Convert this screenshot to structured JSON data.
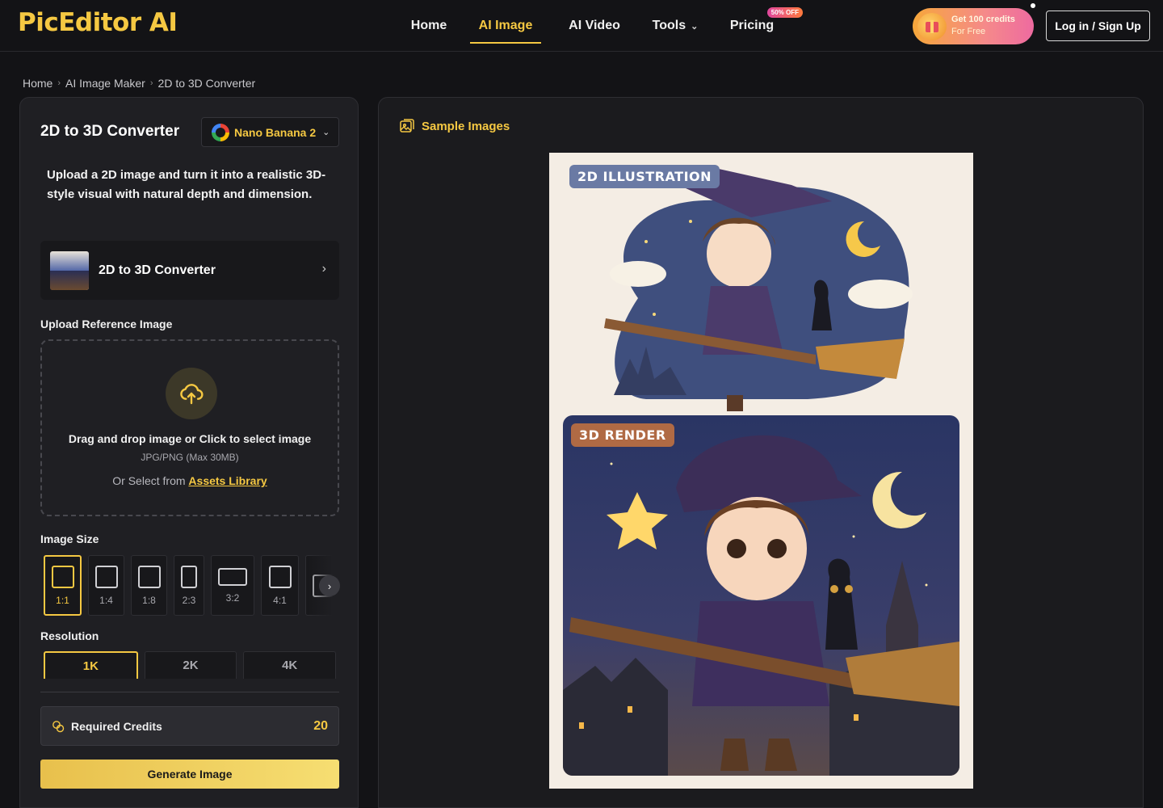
{
  "header": {
    "logo": "PicEditor AI",
    "nav": [
      {
        "label": "Home"
      },
      {
        "label": "AI Image"
      },
      {
        "label": "AI Video"
      },
      {
        "label": "Tools"
      },
      {
        "label": "Pricing"
      }
    ],
    "pricing_badge": "50% OFF",
    "promo_line1": "Get 100 credits",
    "promo_line2": "For Free",
    "login_label": "Log in / Sign Up"
  },
  "breadcrumb": [
    "Home",
    "AI Image Maker",
    "2D to 3D Converter"
  ],
  "tool": {
    "title": "2D to 3D Converter",
    "model": "Nano Banana 2",
    "description": "Upload a 2D image and turn it into a realistic 3D-style visual with natural depth and dimension.",
    "template_label": "2D to 3D Converter",
    "upload_section_label": "Upload Reference Image",
    "upload_main_text": "Drag and drop image or Click to select image",
    "upload_format_text": "JPG/PNG (Max 30MB)",
    "upload_assets_prefix": "Or Select from",
    "upload_assets_link": "Assets Library",
    "image_size_label": "Image Size",
    "sizes": [
      "1:1",
      "1:4",
      "1:8",
      "2:3",
      "3:2",
      "4:1"
    ],
    "selected_size": "1:1",
    "resolution_label": "Resolution",
    "resolutions": [
      "1K",
      "2K",
      "4K"
    ],
    "selected_resolution": "1K",
    "credits_label": "Required Credits",
    "credits_value": "20",
    "generate_label": "Generate Image"
  },
  "samples": {
    "title": "Sample Images",
    "tag_2d": "2D ILLUSTRATION",
    "tag_3d": "3D RENDER"
  },
  "colors": {
    "accent": "#f5c842",
    "background": "#131316",
    "panel": "#1f1f23"
  }
}
